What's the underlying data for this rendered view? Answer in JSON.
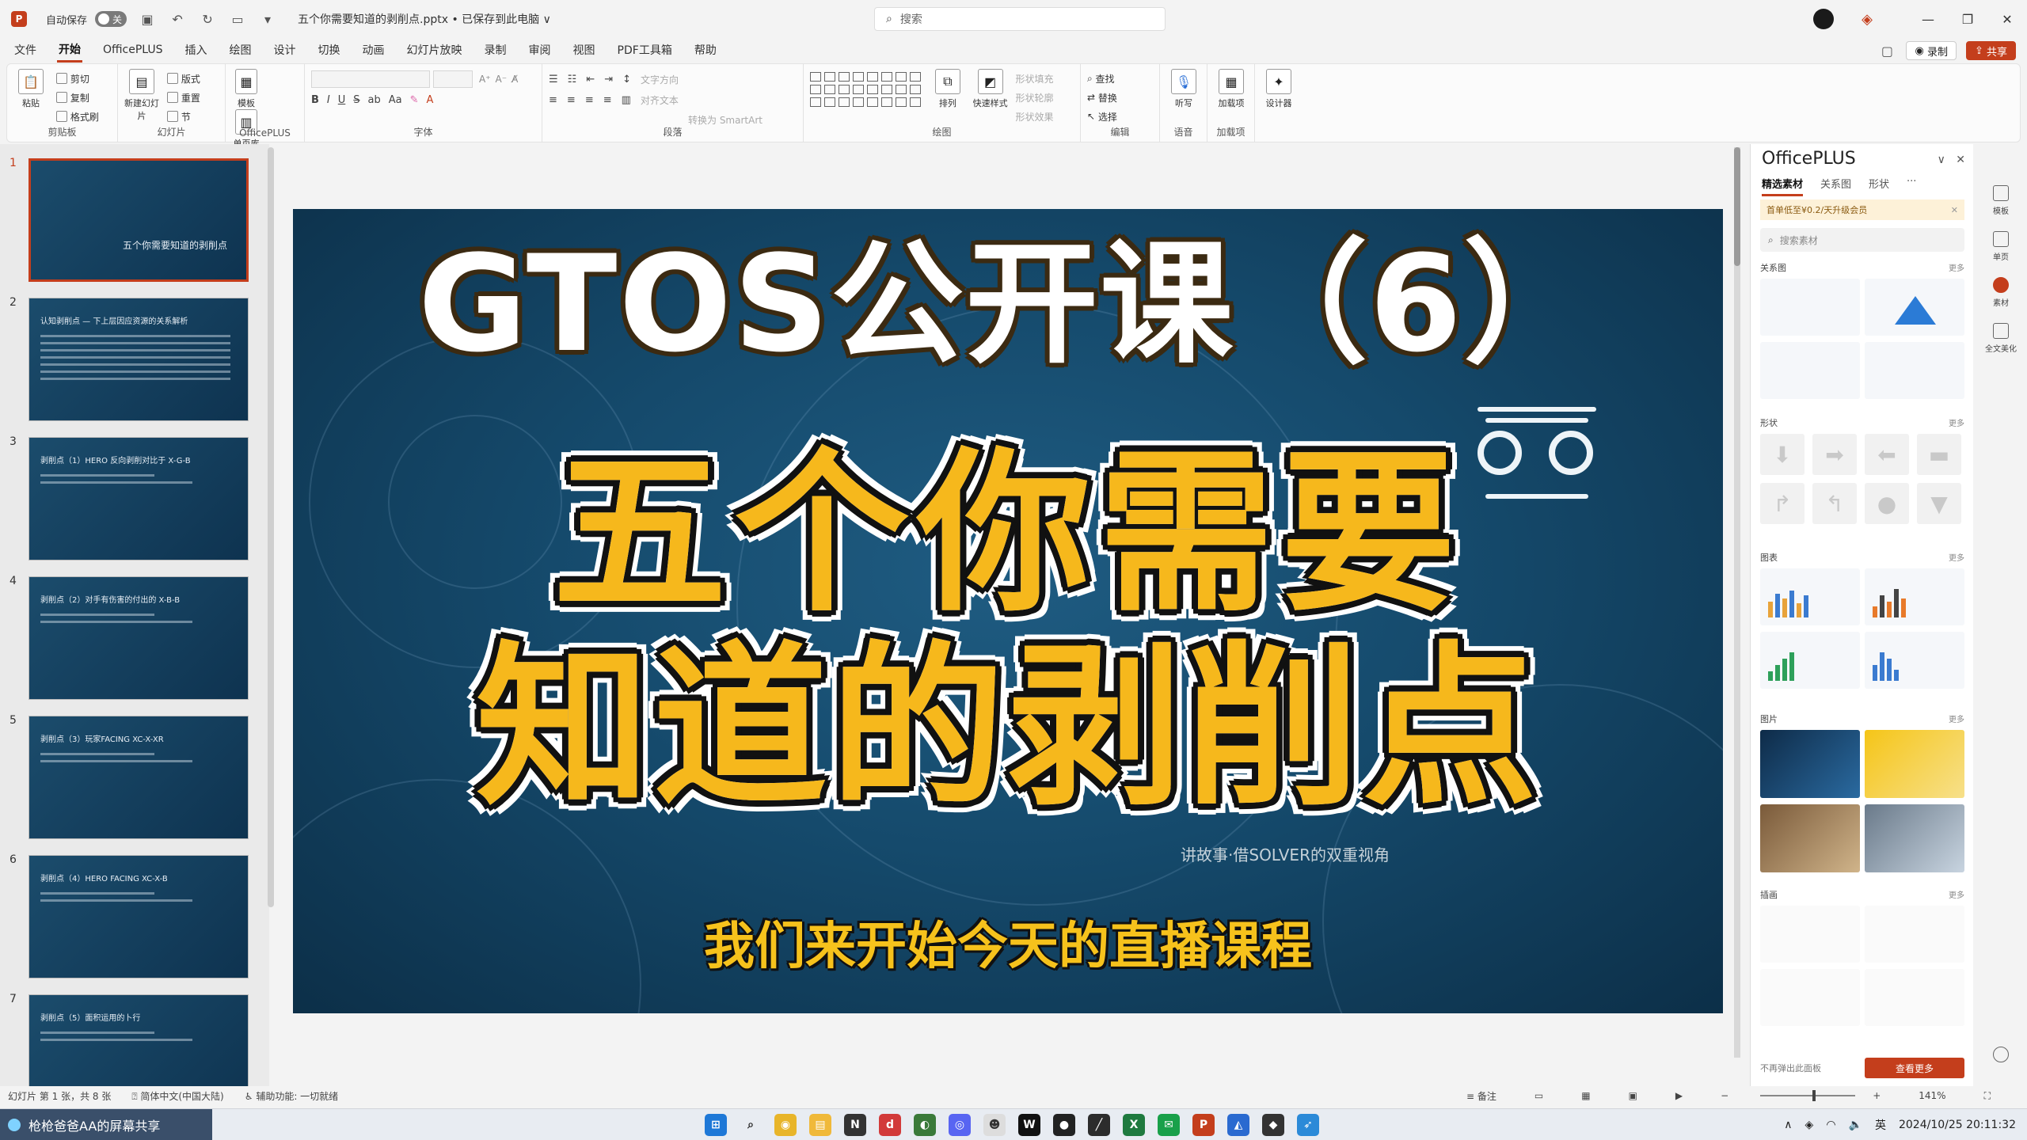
{
  "titlebar": {
    "autosave_label": "自动保存",
    "autosave_state": "关",
    "doc_title": "五个你需要知道的剥削点.pptx • 已保存到此电脑 ∨",
    "search_placeholder": "搜索"
  },
  "tabs": [
    "文件",
    "开始",
    "OfficePLUS",
    "插入",
    "绘图",
    "设计",
    "切换",
    "动画",
    "幻灯片放映",
    "录制",
    "审阅",
    "视图",
    "PDF工具箱",
    "帮助"
  ],
  "tabs_right": {
    "record": "录制",
    "share": "共享"
  },
  "ribbon": {
    "clipboard": {
      "paste": "粘贴",
      "cut": "剪切",
      "copy": "复制",
      "format_painter": "格式刷",
      "label": "剪贴板"
    },
    "slides": {
      "new_slide": "新建幻灯片",
      "layout": "版式",
      "reset": "重置",
      "section": "节",
      "label": "幻灯片"
    },
    "officeplus": {
      "template": "模板",
      "single_page": "单页库",
      "label": "OfficePLUS"
    },
    "font": {
      "label": "字体"
    },
    "paragraph": {
      "text_direction": "文字方向",
      "align_text": "对齐文本",
      "smartart": "转换为 SmartArt",
      "label": "段落"
    },
    "drawing": {
      "arrange": "排列",
      "quick_styles": "快速样式",
      "fill": "形状填充",
      "outline": "形状轮廓",
      "effects": "形状效果",
      "label": "绘图"
    },
    "editing": {
      "find": "查找",
      "replace": "替换",
      "select": "选择",
      "label": "编辑"
    },
    "voice": {
      "dictate": "听写",
      "label": "语音"
    },
    "addins": {
      "addins": "加载项",
      "label": "加载项"
    },
    "designer": {
      "designer": "设计器"
    }
  },
  "thumbnails": [
    {
      "num": "1",
      "title": "五个你需要知道的剥削点"
    },
    {
      "num": "2",
      "title": "认知剥削点 — 下上层因应资源的关系解析"
    },
    {
      "num": "3",
      "title": "剥削点（1）HERO 反向剥削对比于 X-G-B"
    },
    {
      "num": "4",
      "title": "剥削点（2）对手有伤害的付出的 X-B-B"
    },
    {
      "num": "5",
      "title": "剥削点（3）玩家FACING XC-X-XR"
    },
    {
      "num": "6",
      "title": "剥削点（4）HERO FACING XC-X-B"
    },
    {
      "num": "7",
      "title": "剥削点（5）面积运用的卜行"
    }
  ],
  "slide": {
    "title_en": "GTOS公开课（6）",
    "main_line1": "五个你需要",
    "main_line2": "知道的剥削点",
    "subtitle_partial": "讲故事·借SOLVER的双重视角",
    "caption": "我们来开始今天的直播课程"
  },
  "officeplus_pane": {
    "title": "OfficePLUS",
    "tabs": [
      "精选素材",
      "关系图",
      "形状",
      "···"
    ],
    "banner": "首单低至¥0.2/天升级会员",
    "search_placeholder": "搜索素材",
    "sections": {
      "diagrams": "关系图",
      "shapes": "形状",
      "charts": "图表",
      "photos": "图片",
      "illustrations": "插画"
    },
    "more": "更多",
    "footer_text": "不再弹出此面板",
    "footer_button": "查看更多"
  },
  "rail": [
    "模板",
    "单页",
    "素材",
    "全文美化"
  ],
  "statusbar": {
    "slide_info": "幻灯片 第 1 张，共 8 张",
    "language": "简体中文(中国大陆)",
    "accessibility": "辅助功能: 一切就绪",
    "notes": "备注",
    "zoom": "141%"
  },
  "taskbar": {
    "share_notice": "枪枪爸爸AA的屏幕共享",
    "tray_lang": "英",
    "datetime": "2024/10/25 20:11:32"
  },
  "colors": {
    "accent": "#c43e1c",
    "slide_bg": "#154a6c",
    "title_yellow": "#f6b81c"
  }
}
